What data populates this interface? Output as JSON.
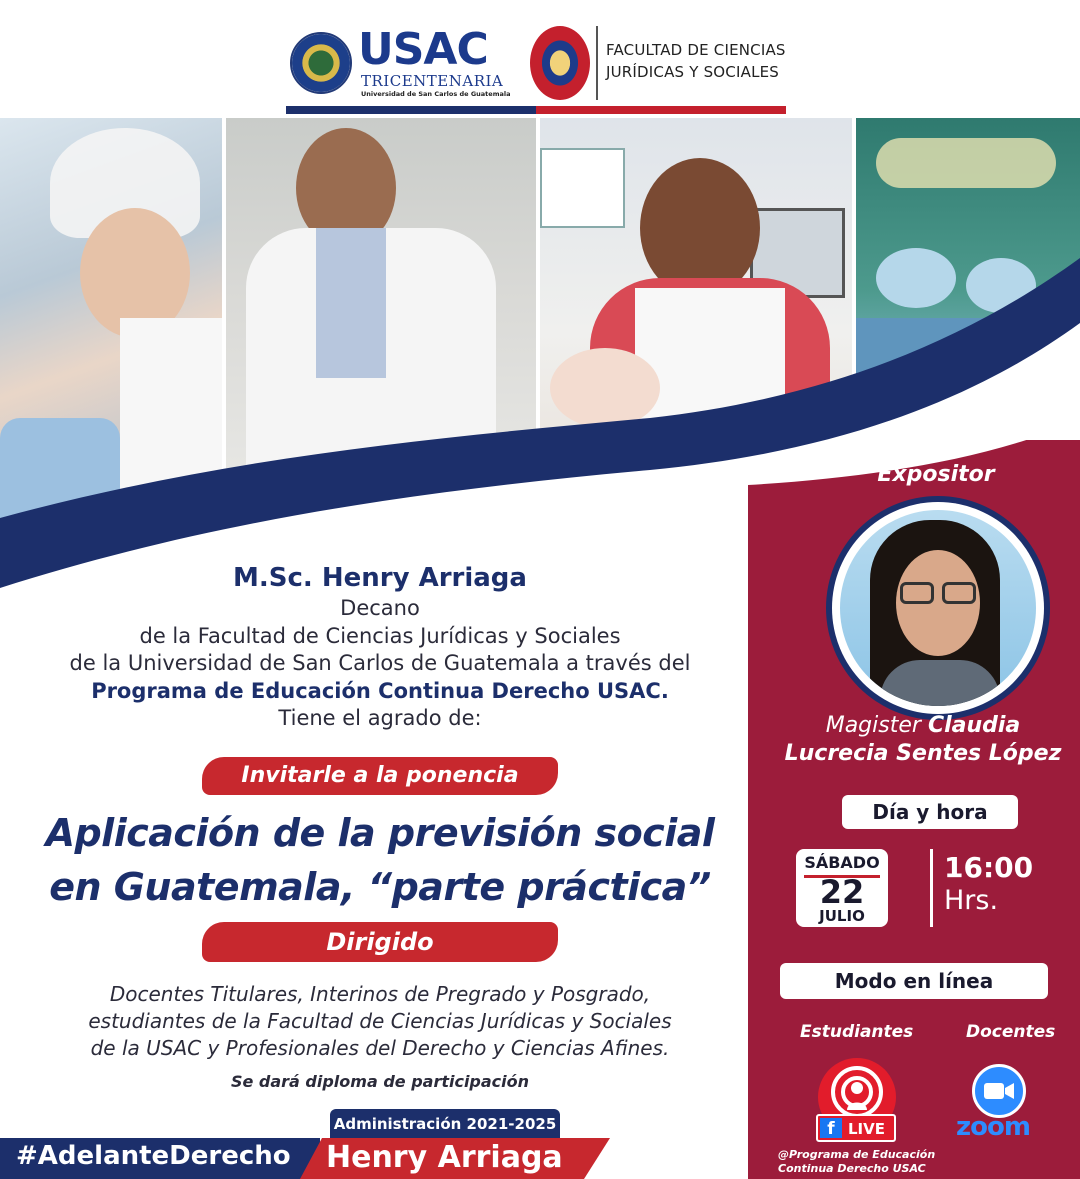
{
  "header": {
    "usac_word": "USAC",
    "usac_tricentenaria": "TRICENTENARIA",
    "usac_university": "Universidad de San Carlos de Guatemala",
    "faculty_line1": "FACULTAD DE CIENCIAS",
    "faculty_line2": "JURÍDICAS Y SOCIALES"
  },
  "host": {
    "name": "M.Sc. Henry Arriaga",
    "role": "Decano",
    "faculty": "de la Facultad de Ciencias Jurídicas y Sociales",
    "university": "de la Universidad de San Carlos de Guatemala a través del",
    "program": "Programa de Educación Continua Derecho USAC.",
    "greeting": "Tiene el agrado de:"
  },
  "event": {
    "invite_label": "Invitarle a la ponencia",
    "title_line1": "Aplicación de la previsión social",
    "title_line2": "en Guatemala, “parte práctica”",
    "dirigido_label": "Dirigido",
    "audience_line1": "Docentes Titulares, Interinos de Pregrado y Posgrado,",
    "audience_line2": "estudiantes de la  Facultad de Ciencias Jurídicas y Sociales",
    "audience_line3": "de la  USAC y Profesionales del Derecho y Ciencias Afines.",
    "diploma_note": "Se dará diploma de participación"
  },
  "speaker": {
    "label": "Expositor",
    "title_prefix": "Magister",
    "first_name": "Claudia",
    "last_names": "Lucrecia Sentes López"
  },
  "schedule": {
    "label": "Día y hora",
    "weekday": "SÁBADO",
    "day": "22",
    "month": "JULIO",
    "time": "16:00",
    "time_unit": "Hrs."
  },
  "online": {
    "label": "Modo en línea",
    "students_label": "Estudiantes",
    "teachers_label": "Docentes",
    "fb_letter": "f",
    "live_label": "LIVE",
    "zoom_label": "zoom",
    "program_handle_line1": "@Programa de Educación",
    "program_handle_line2": "Continua Derecho USAC"
  },
  "footer": {
    "administration": "Administración 2021-2025",
    "hashtag": "#AdelanteDerecho",
    "name": "Henry Arriaga"
  },
  "colors": {
    "navy": "#1c2f6b",
    "crimson": "#9c1c3b",
    "red": "#c7282e",
    "facebook": "#1877f2",
    "zoom": "#2d8cff"
  },
  "icons": [
    "university-seal-icon",
    "faculty-seal-icon",
    "facebook-live-icon",
    "zoom-icon"
  ]
}
